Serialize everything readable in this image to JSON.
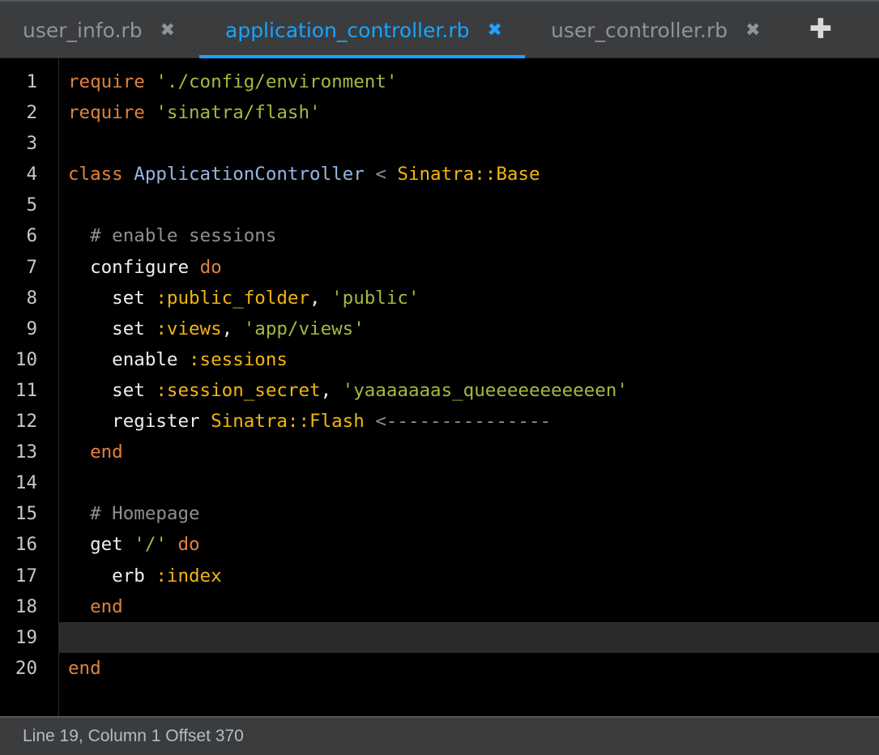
{
  "tabs": [
    {
      "label": "user_info.rb",
      "close": "✖",
      "active": false
    },
    {
      "label": "application_controller.rb",
      "close": "✖",
      "active": true
    },
    {
      "label": "user_controller.rb",
      "close": "✖",
      "active": false
    }
  ],
  "add_tab_label": "✚",
  "colors": {
    "active_tab": "#1aa3ff",
    "keyword": "#e0823d",
    "string": "#a9b73f",
    "symbol": "#f2b50f",
    "class_name": "#97b6e0",
    "comment": "#8f8f8f"
  },
  "code_lines": [
    {
      "num": "1",
      "tokens": [
        [
          "kw",
          "require"
        ],
        [
          "plain",
          " "
        ],
        [
          "str",
          "'./config/environment'"
        ]
      ]
    },
    {
      "num": "2",
      "tokens": [
        [
          "kw",
          "require"
        ],
        [
          "plain",
          " "
        ],
        [
          "str",
          "'sinatra/flash'"
        ]
      ]
    },
    {
      "num": "3",
      "tokens": []
    },
    {
      "num": "4",
      "tokens": [
        [
          "kw",
          "class"
        ],
        [
          "plain",
          " "
        ],
        [
          "cls",
          "ApplicationController"
        ],
        [
          "plain",
          " "
        ],
        [
          "op",
          "<"
        ],
        [
          "plain",
          " "
        ],
        [
          "const",
          "Sinatra::Base"
        ]
      ]
    },
    {
      "num": "5",
      "tokens": []
    },
    {
      "num": "6",
      "tokens": [
        [
          "plain",
          "  "
        ],
        [
          "cmt",
          "# enable sessions"
        ]
      ]
    },
    {
      "num": "7",
      "tokens": [
        [
          "plain",
          "  configure "
        ],
        [
          "kw",
          "do"
        ]
      ]
    },
    {
      "num": "8",
      "tokens": [
        [
          "plain",
          "    set "
        ],
        [
          "sym",
          ":public_folder"
        ],
        [
          "plain",
          ", "
        ],
        [
          "str",
          "'public'"
        ]
      ]
    },
    {
      "num": "9",
      "tokens": [
        [
          "plain",
          "    set "
        ],
        [
          "sym",
          ":views"
        ],
        [
          "plain",
          ", "
        ],
        [
          "str",
          "'app/views'"
        ]
      ]
    },
    {
      "num": "10",
      "tokens": [
        [
          "plain",
          "    enable "
        ],
        [
          "sym",
          ":sessions"
        ]
      ]
    },
    {
      "num": "11",
      "tokens": [
        [
          "plain",
          "    set "
        ],
        [
          "sym",
          ":session_secret"
        ],
        [
          "plain",
          ", "
        ],
        [
          "str",
          "'yaaaaaaas_queeeeeeeeeeen'"
        ]
      ]
    },
    {
      "num": "12",
      "tokens": [
        [
          "plain",
          "    register "
        ],
        [
          "const",
          "Sinatra::Flash"
        ],
        [
          "plain",
          " "
        ],
        [
          "op",
          "<---------------"
        ]
      ]
    },
    {
      "num": "13",
      "tokens": [
        [
          "plain",
          "  "
        ],
        [
          "kw",
          "end"
        ]
      ]
    },
    {
      "num": "14",
      "tokens": []
    },
    {
      "num": "15",
      "tokens": [
        [
          "plain",
          "  "
        ],
        [
          "cmt",
          "# Homepage"
        ]
      ]
    },
    {
      "num": "16",
      "tokens": [
        [
          "plain",
          "  get "
        ],
        [
          "str",
          "'/'"
        ],
        [
          "plain",
          " "
        ],
        [
          "kw",
          "do"
        ]
      ]
    },
    {
      "num": "17",
      "tokens": [
        [
          "plain",
          "    erb "
        ],
        [
          "sym",
          ":index"
        ]
      ]
    },
    {
      "num": "18",
      "tokens": [
        [
          "plain",
          "  "
        ],
        [
          "kw",
          "end"
        ]
      ]
    },
    {
      "num": "19",
      "tokens": [],
      "current": true
    },
    {
      "num": "20",
      "tokens": [
        [
          "kw",
          "end"
        ]
      ]
    }
  ],
  "status": {
    "text": "Line 19, Column 1 Offset 370"
  }
}
